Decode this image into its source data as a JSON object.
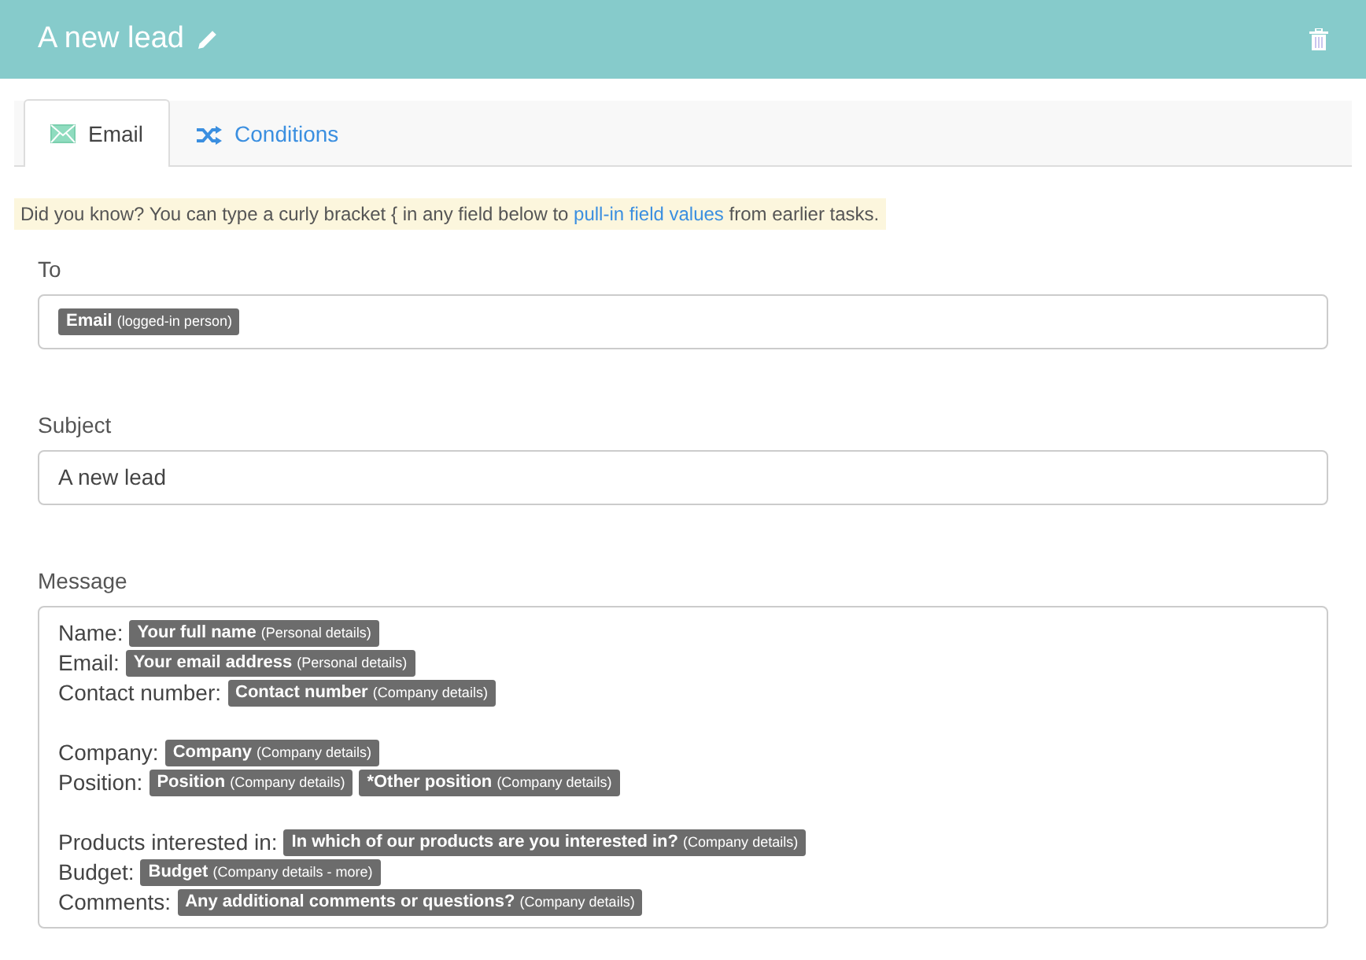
{
  "header": {
    "title": "A new lead"
  },
  "tabs": [
    {
      "label": "Email",
      "selected": true
    },
    {
      "label": "Conditions",
      "selected": false
    }
  ],
  "notice": {
    "text": "Did you know? You can type a curly bracket { in any field below to ",
    "link": "pull-in field values",
    "after": " from earlier tasks."
  },
  "to": {
    "label": "To",
    "tokens": [
      {
        "field": "Email",
        "source": "(logged-in person)"
      }
    ]
  },
  "subject": {
    "label": "Subject",
    "value": "A new lead"
  },
  "message": {
    "label": "Message",
    "groups": [
      [
        {
          "label": "Name:",
          "tokens": [
            {
              "field": "Your full name",
              "source": "(Personal details)"
            }
          ]
        },
        {
          "label": "Email:",
          "tokens": [
            {
              "field": "Your email address",
              "source": "(Personal details)"
            }
          ]
        },
        {
          "label": "Contact number:",
          "tokens": [
            {
              "field": "Contact number",
              "source": "(Company details)"
            }
          ]
        }
      ],
      [
        {
          "label": "Company:",
          "tokens": [
            {
              "field": "Company",
              "source": "(Company details)"
            }
          ]
        },
        {
          "label": "Position:",
          "tokens": [
            {
              "field": "Position",
              "source": "(Company details)"
            },
            {
              "field": "*Other position",
              "source": "(Company details)"
            }
          ]
        }
      ],
      [
        {
          "label": "Products interested in:",
          "tokens": [
            {
              "field": "In which of our products are you interested in?",
              "source": "(Company details)"
            }
          ]
        },
        {
          "label": "Budget:",
          "tokens": [
            {
              "field": "Budget",
              "source": "(Company details - more)"
            }
          ]
        },
        {
          "label": "Comments:",
          "tokens": [
            {
              "field": "Any additional comments or questions?",
              "source": "(Company details)"
            }
          ]
        }
      ]
    ]
  }
}
